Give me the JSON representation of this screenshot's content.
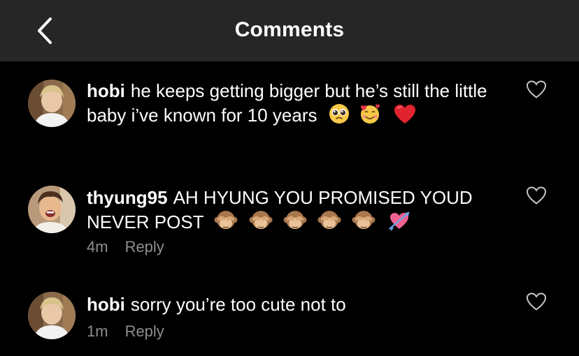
{
  "header": {
    "title": "Comments"
  },
  "comments": [
    {
      "username": "hobi",
      "text": "he keeps getting bigger but he’s still the little baby i’ve known for 10 years",
      "emojis": [
        "pleading-face",
        "smiling-face-with-hearts",
        "red-heart"
      ],
      "time": "",
      "reply_label": ""
    },
    {
      "username": "thyung95",
      "text": "AH HYUNG YOU PROMISED YOUD NEVER POST",
      "emojis": [
        "see-no-evil-monkey",
        "see-no-evil-monkey",
        "see-no-evil-monkey",
        "see-no-evil-monkey",
        "see-no-evil-monkey",
        "heart-with-arrow"
      ],
      "time": "4m",
      "reply_label": "Reply"
    },
    {
      "username": "hobi",
      "text": "sorry you’re too cute not to",
      "emojis": [],
      "time": "1m",
      "reply_label": "Reply"
    }
  ],
  "colors": {
    "background": "#000000",
    "header": "#262626",
    "meta_text": "#8e8e8e",
    "heart_outline": "#c7c7c7"
  }
}
